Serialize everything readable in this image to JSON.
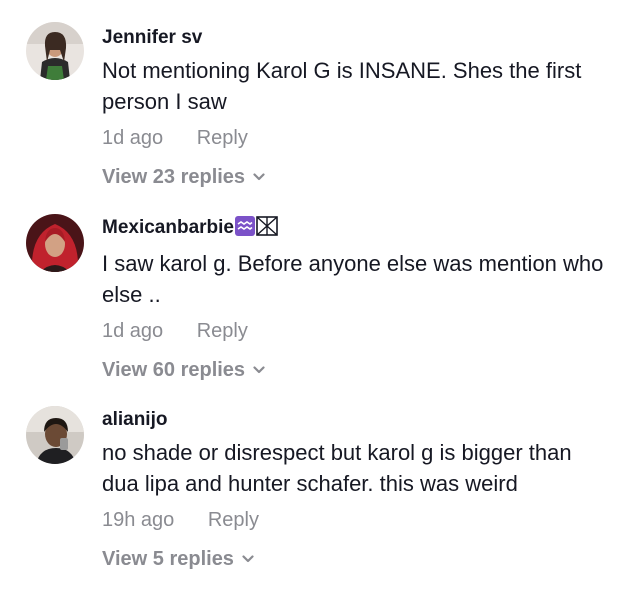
{
  "comments": [
    {
      "username": "Jennifer sv",
      "text_lines": [
        "Not mentioning Karol G is INSANE. Shes the first",
        "person I saw"
      ],
      "time": "1d ago",
      "reply_label": "Reply",
      "view_replies": "View 23 replies"
    },
    {
      "username": "Mexicanbarbie",
      "text_lines": [
        "I saw karol g. Before anyone else was mention who",
        "else .."
      ],
      "time": "1d ago",
      "reply_label": "Reply",
      "view_replies": "View 60 replies"
    },
    {
      "username": "alianijo",
      "text_lines": [
        "no shade or disrespect but karol g is bigger than",
        "dua lipa and hunter schafer. this was weird"
      ],
      "time": "19h ago",
      "reply_label": "Reply",
      "view_replies": "View 5 replies"
    }
  ],
  "icons": {
    "expand": "chevron-down-icon",
    "badge_1": "aquarius-icon",
    "badge_2": "missing-glyph-icon"
  },
  "colors": {
    "text": "#161823",
    "secondary": "#8a8b91",
    "badge": "#7b52c8"
  }
}
